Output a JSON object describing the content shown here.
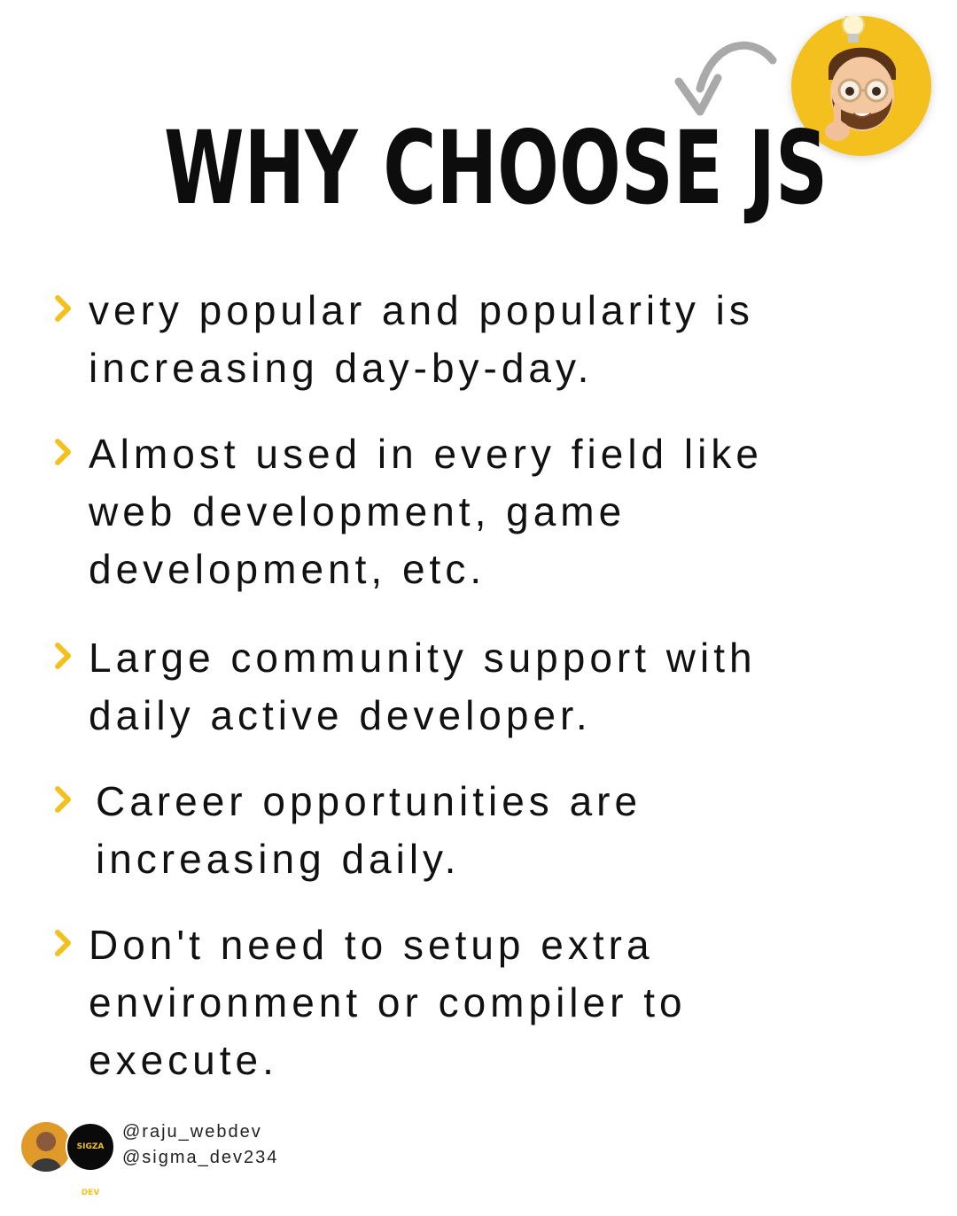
{
  "title": "WHY CHOOSE JS",
  "accent_color": "#f4c01e",
  "icons": {
    "bullet": "chevron-right-icon",
    "arrow": "curved-arrow-icon",
    "avatar": "memoji-lightbulb-avatar-icon"
  },
  "items": [
    {
      "lines": [
        "very popular and popularity is",
        "increasing day-by-day."
      ]
    },
    {
      "lines": [
        "Almost used in every field like",
        "web development, game",
        "development, etc."
      ]
    },
    {
      "lines": [
        "Large community support with",
        "daily active developer."
      ]
    },
    {
      "lines": [
        "Career opportunities are",
        "increasing daily."
      ]
    },
    {
      "lines": [
        "Don't need to setup extra",
        "environment or compiler to",
        "execute."
      ]
    }
  ],
  "footer": {
    "badge_text": "SIGZA DEV",
    "handles": [
      "@raju_webdev",
      "@sigma_dev234"
    ]
  }
}
